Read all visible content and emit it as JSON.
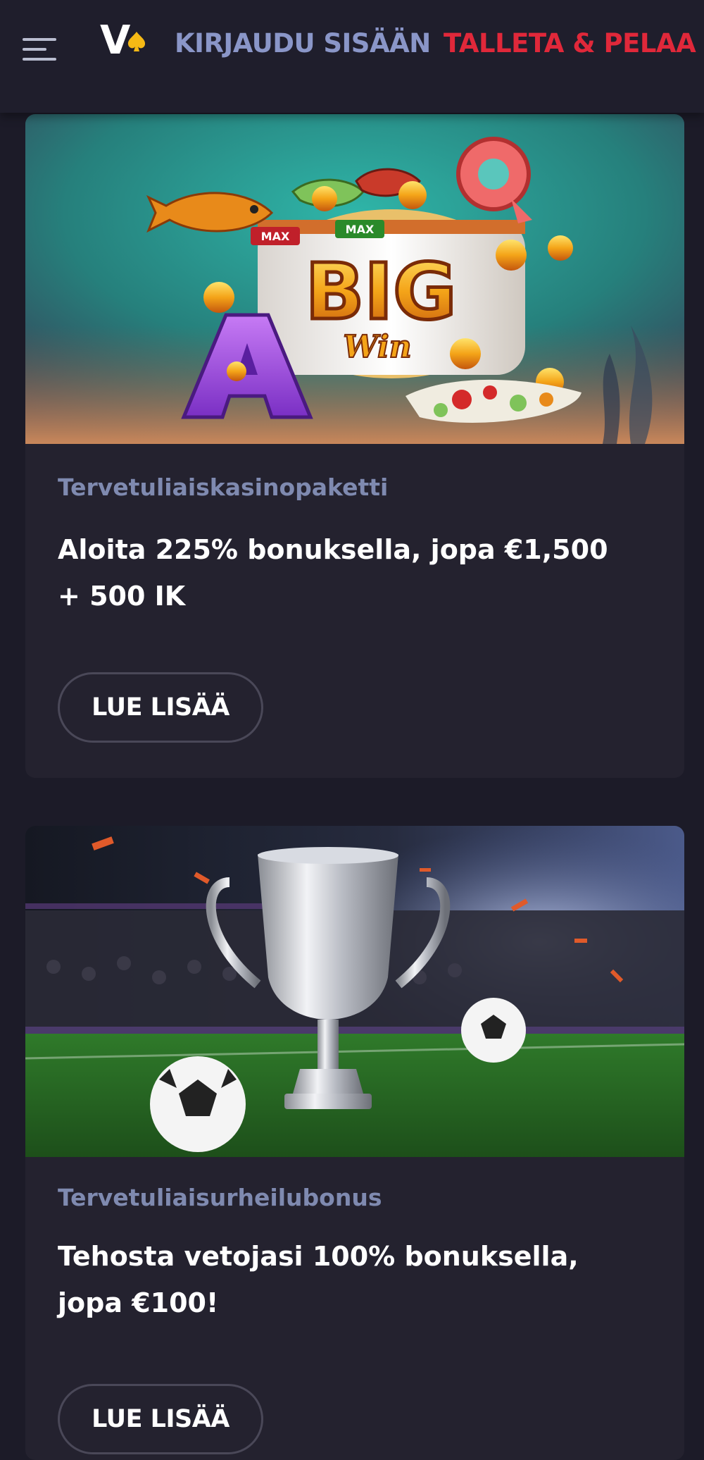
{
  "header": {
    "menu_icon": "hamburger-menu-icon",
    "logo_icon": "spade-logo-icon",
    "logo_letter": "V",
    "login_label": "KIRJAUDU SISÄÄN",
    "deposit_label": "TALLETA & PELAA",
    "colors": {
      "login": "#8a96c8",
      "deposit": "#e0283a"
    }
  },
  "promotions": [
    {
      "image": "big-win-slot-banner",
      "banner_text": {
        "big": "BIG",
        "win": "Win",
        "max": "MAX"
      },
      "label": "Tervetuliaiskasinopaketti",
      "title": "Aloita 225% bonuksella, jopa €1,500 + 500 IK",
      "button_label": "LUE LISÄÄ"
    },
    {
      "image": "football-trophy-banner",
      "label": "Tervetuliaisurheilubonus",
      "title": "Tehosta vetojasi 100% bonuksella, jopa €100!",
      "button_label": "LUE LISÄÄ"
    }
  ]
}
